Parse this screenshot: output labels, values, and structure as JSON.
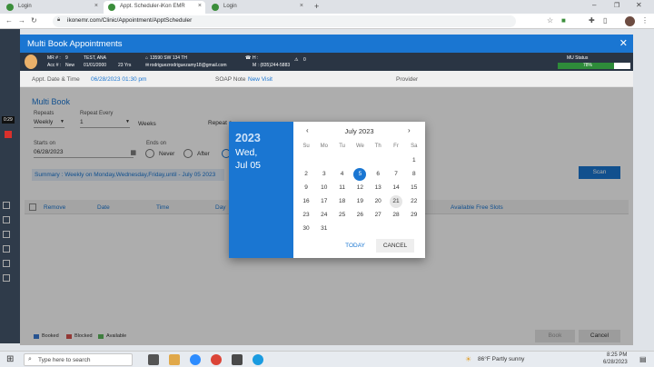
{
  "browser": {
    "tabs": [
      {
        "label": "Login"
      },
      {
        "label": "Appt. Scheduler-iKon EMR"
      },
      {
        "label": "Login"
      }
    ],
    "url": "ikonemr.com/Clinic/Appointment/ApptScheduler"
  },
  "modal": {
    "title": "Multi Book Appointments"
  },
  "patient": {
    "mr_label": "MR # :",
    "mr_value": "9",
    "acc_label": "Acc # :",
    "acc_value": "New",
    "name": "TEST, ANA",
    "dob": "01/01/2000",
    "age": "23 Yrs",
    "address": "13590 SW 134 TH",
    "email": "rodriguezrodriguezamy18@gmail.com",
    "home_label": "H :",
    "mobile": "M : (835)244-5883",
    "alerts_count": "0",
    "mu_label": "MU Status",
    "mu_value": "78%",
    "mu_percent": 78
  },
  "appt": {
    "date_label": "Appt. Date & Time",
    "date_value": "06/28/2023 01:30 pm",
    "soap_label": "SOAP Note",
    "soap_value": "New Visit",
    "provider_label": "Provider"
  },
  "multibook": {
    "title": "Multi Book",
    "repeats_label": "Repeats",
    "repeats_value": "Weekly",
    "repeat_every_label": "Repeat Every",
    "repeat_every_value": "1",
    "weeks_label": "Weeks",
    "repeat_on_label": "Repeat o",
    "starts_on_label": "Starts on",
    "starts_on_value": "06/28/2023",
    "ends_on_label": "Ends on",
    "ends_never": "Never",
    "ends_after": "After",
    "summary": "Summary : Weekly on Monday,Wednesday,Friday,until - July 05 2023",
    "scan_label": "Scan"
  },
  "table": {
    "columns": [
      "Remove",
      "Date",
      "Time",
      "Day",
      "Available Free Slots"
    ]
  },
  "legend": {
    "booked": "Booked",
    "blocked": "Blocked",
    "available": "Available"
  },
  "footer": {
    "book_label": "Book",
    "cancel_label": "Cancel"
  },
  "datepicker": {
    "year": "2023",
    "date_line1": "Wed,",
    "date_line2": "Jul 05",
    "month": "July 2023",
    "weekdays": [
      "Su",
      "Mo",
      "Tu",
      "We",
      "Th",
      "Fr",
      "Sa"
    ],
    "first_weekday_index": 6,
    "days_in_month": 31,
    "selected_day": 5,
    "hovered_day": 21,
    "today_label": "TODAY",
    "cancel_label": "CANCEL"
  },
  "taskbar": {
    "search_placeholder": "Type here to search",
    "weather": "86°F  Partly sunny",
    "time": "8:25 PM",
    "date": "6/28/2023"
  }
}
